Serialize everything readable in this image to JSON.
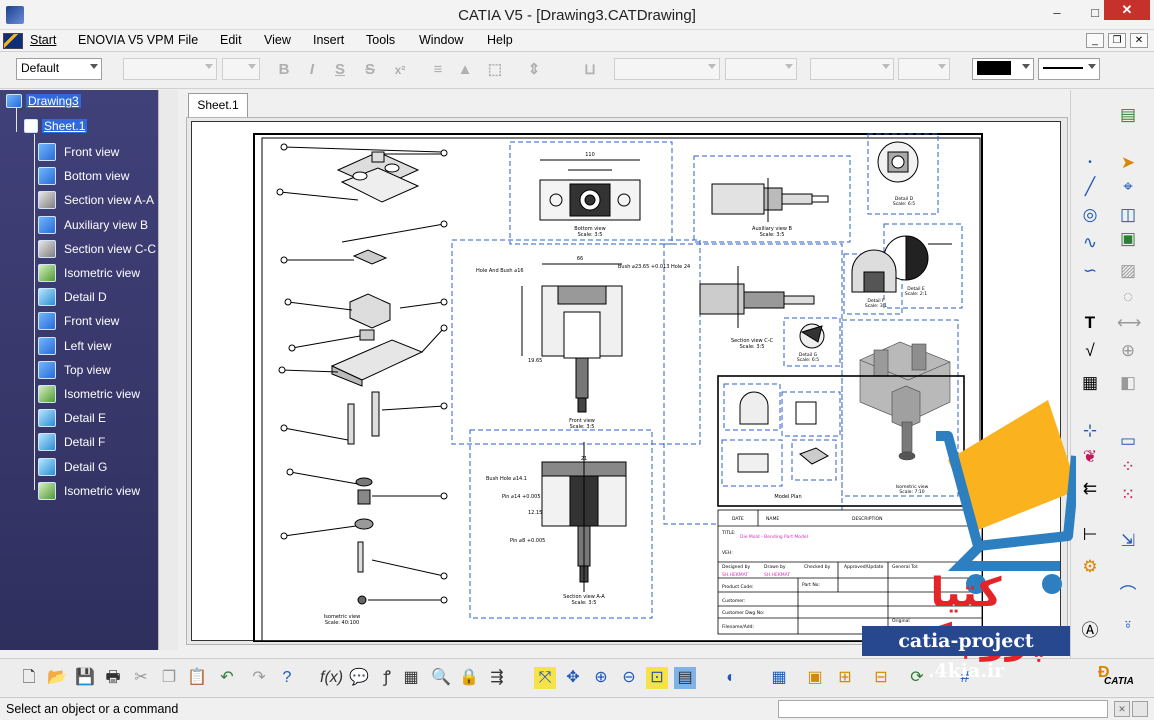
{
  "window": {
    "title": "CATIA V5 - [Drawing3.CATDrawing]",
    "min": "–",
    "max": "□",
    "close": "✕"
  },
  "menu": {
    "items": [
      "Start",
      "ENOVIA V5 VPM",
      "File",
      "Edit",
      "View",
      "Insert",
      "Tools",
      "Window",
      "Help"
    ]
  },
  "format_toolbar": {
    "style_value": "Default",
    "bold": "B",
    "italic": "I",
    "underline": "S",
    "strike": "S",
    "superscript": "x²"
  },
  "tree": {
    "root": "Drawing3",
    "sheet": "Sheet.1",
    "items": [
      {
        "label": "Front view",
        "icon": "front-view-icon"
      },
      {
        "label": "Bottom view",
        "icon": "bottom-view-icon"
      },
      {
        "label": "Section view A-A",
        "icon": "section-view-icon"
      },
      {
        "label": "Auxiliary view B",
        "icon": "auxiliary-view-icon"
      },
      {
        "label": "Section view C-C",
        "icon": "section-view-icon"
      },
      {
        "label": "Isometric view",
        "icon": "isometric-view-icon"
      },
      {
        "label": "Detail D",
        "icon": "detail-view-icon"
      },
      {
        "label": "Front view",
        "icon": "front-view-icon"
      },
      {
        "label": "Left view",
        "icon": "left-view-icon"
      },
      {
        "label": "Top view",
        "icon": "top-view-icon"
      },
      {
        "label": "Isometric view",
        "icon": "isometric-view-icon"
      },
      {
        "label": "Detail E",
        "icon": "detail-view-icon"
      },
      {
        "label": "Detail F",
        "icon": "detail-view-icon"
      },
      {
        "label": "Detail G",
        "icon": "detail-view-icon"
      },
      {
        "label": "Isometric view",
        "icon": "isometric-view-icon"
      }
    ]
  },
  "sheet_tab": "Sheet.1",
  "drawing": {
    "view_labels": {
      "bottom": "Bottom view\nScale: 3:5",
      "aux": "Auxiliary view B\nScale: 3:5",
      "detail_d": "Detail D\nScale: 6:5",
      "detail_e": "Detail E\nScale: 2:1",
      "detail_f": "Detail F\nScale: 3:1",
      "front": "Front view\nScale: 3:5",
      "section_cc": "Section view C-C\nScale: 3:5",
      "detail_g": "Detail G\nScale: 6:5",
      "section_aa": "Section view A-A\nScale: 3:5",
      "iso_main": "Isometric view\nScale: 40:100",
      "iso_small": "Isometric view\nScale: 7:10",
      "model_plan": "Model Plan"
    },
    "annotations": {
      "hole_bush": "Hole And Bush ⌀16",
      "bush_hole_24": "Bush ⌀23.65 +0.013 Hole 24",
      "bush_hole_141": "Bush Hole ⌀14.1",
      "pin1": "Pin ⌀14 +0.005",
      "pin2": "Pin ⌀8 +0.005",
      "dim_110": "110",
      "dim_66": "66",
      "dim_21": "21",
      "dim_1265": "12.15",
      "dim_1965": "19.65"
    },
    "title_block": {
      "date": "DATE",
      "name": "NAME",
      "description": "DESCRIPTION",
      "title_label": "TITLE:",
      "title_value": "Die Mold - Bending Part Model",
      "veh": "VEH:",
      "designed_by": "Designed by",
      "designed_value": "SH.HEKMAT",
      "drawn_by": "Drawn by",
      "drawn_value": "SH.HEKMAT",
      "checked_by": "Checked by",
      "approved": "Approved/Update",
      "general_tol": "General Tol:",
      "product_code": "Product Code:",
      "part_no": "Part No:",
      "customer": "Customer:",
      "customer_dwg": "Customer Dwg No:",
      "filename": "Filename/Add:",
      "original": "Original"
    }
  },
  "watermark": {
    "text": "کتیا پروجکت",
    "url": "catia-project .4kia.ir"
  },
  "status": {
    "text": "Select an object or a command",
    "brand": "CATIA"
  },
  "colors": {
    "tree_bg": "#3a3a6e",
    "tree_selected": "#2f6ad8",
    "close_red": "#c7312b",
    "view_frame_blue": "#2b5fc8",
    "watermark_red": "#e3252a",
    "watermark_blue": "#27478f",
    "cart_orange": "#fbb21f",
    "cart_blue": "#2d7fc0"
  }
}
